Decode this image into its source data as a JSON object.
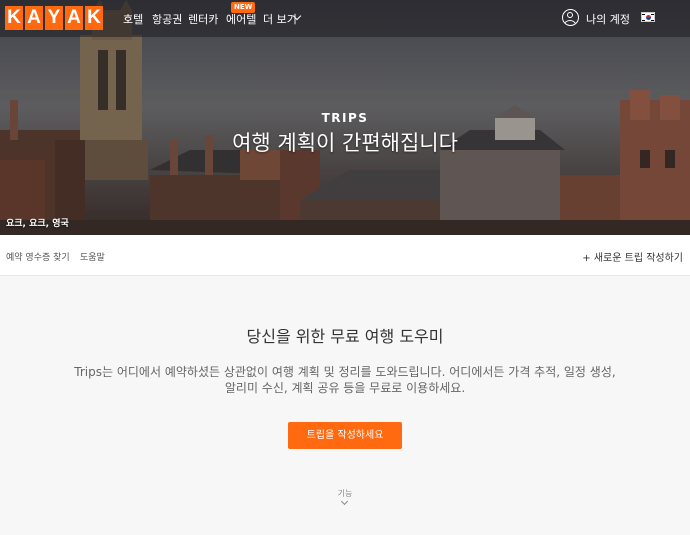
{
  "logo_letters": [
    "K",
    "A",
    "Y",
    "A",
    "K"
  ],
  "nav": {
    "links": [
      "호텔",
      "항공권",
      "렌터카",
      "에어텔",
      "더 보기"
    ],
    "new_badge": "NEW",
    "account": "나의 계정",
    "flag": "korea-flag-icon"
  },
  "hero": {
    "eyebrow": "TRIPS",
    "title": "여행 계획이 간편해집니다",
    "photo_location": "요크, 요크, 영국"
  },
  "subnav": {
    "find_receipt": "예약 영수증 찾기",
    "help": "도움말",
    "new_trip": "+ 새로운 트립 작성하기"
  },
  "main": {
    "title": "당신을 위한 무료 여행 도우미",
    "description_line1": "Trips는 어디에서 예약하셨든 상관없이 여행 계획 및 정리를 도와드립니다. 어디에서든 가격 추적, 일정 생성,",
    "description_line2": "알리미 수신, 계획 공유 등을 무료로 이용하세요.",
    "cta": "트립을 작성하세요",
    "features": "기능"
  },
  "colors": {
    "brand": "#ff690f"
  }
}
